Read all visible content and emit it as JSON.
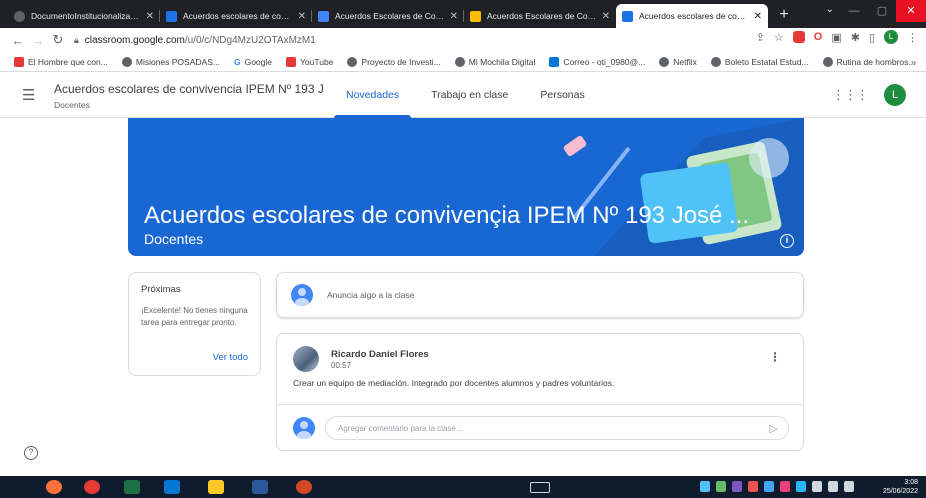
{
  "browser": {
    "tabs": [
      {
        "label": "DocumentoInstitucionalizacion",
        "color": "#5f6368"
      },
      {
        "label": "Acuerdos escolares de convive",
        "color": "#1a73e8"
      },
      {
        "label": "Acuerdos Escolares de Conviv",
        "color": "#4285f4"
      },
      {
        "label": "Acuerdos Escolares de Convive",
        "color": "#fbbc04"
      },
      {
        "label": "Acuerdos escolares de convive",
        "color": "#1a73e8"
      }
    ],
    "url_host": "classroom.google.com",
    "url_path": "/u/0/c/NDg4MzU2OTAxMzM1",
    "bookmarks": [
      {
        "label": "El Hombre que con...",
        "color": "#e53935"
      },
      {
        "label": "Misiones POSADAS...",
        "color": "#5f6368"
      },
      {
        "label": "Google",
        "color": "#4285f4"
      },
      {
        "label": "YouTube",
        "color": "#e53935"
      },
      {
        "label": "Proyecto de Investi...",
        "color": "#5f6368"
      },
      {
        "label": "Mi Mochila Digital",
        "color": "#5f6368"
      },
      {
        "label": "Correo - oti_0980@...",
        "color": "#0078d4"
      },
      {
        "label": "Netflix",
        "color": "#5f6368"
      },
      {
        "label": "Boleto Estatal Estud...",
        "color": "#5f6368"
      },
      {
        "label": "Rutina de hombros...",
        "color": "#5f6368"
      }
    ],
    "profile_letter": "L"
  },
  "classroom": {
    "course_title": "Acuerdos escolares de convivencia IPEM Nº 193 J...",
    "course_section": "Docentes",
    "nav_tabs": [
      "Novedades",
      "Trabajo en clase",
      "Personas"
    ],
    "active_tab": "Novedades",
    "user_letter": "L",
    "accent": "#1967d2"
  },
  "banner": {
    "title": "Acuerdos escolares de convivençia IPEM Nº 193 José ...",
    "subtitle": "Docentes"
  },
  "upcoming": {
    "title": "Próximas",
    "text": "¡Excelente! No tienes ninguna tarea para entregar pronto.",
    "link": "Ver todo"
  },
  "stream": {
    "announce_placeholder": "Anuncia algo a la clase",
    "post": {
      "author": "Ricardo Daniel Flores",
      "time": "00:57",
      "body": "Crear un equipo de mediación. Integrado por docentes alumnos y padres voluntarios.",
      "comment_placeholder": "Agregar comentario para la clase..."
    }
  },
  "taskbar": {
    "time": "3:08",
    "date": "25/06/2022"
  }
}
